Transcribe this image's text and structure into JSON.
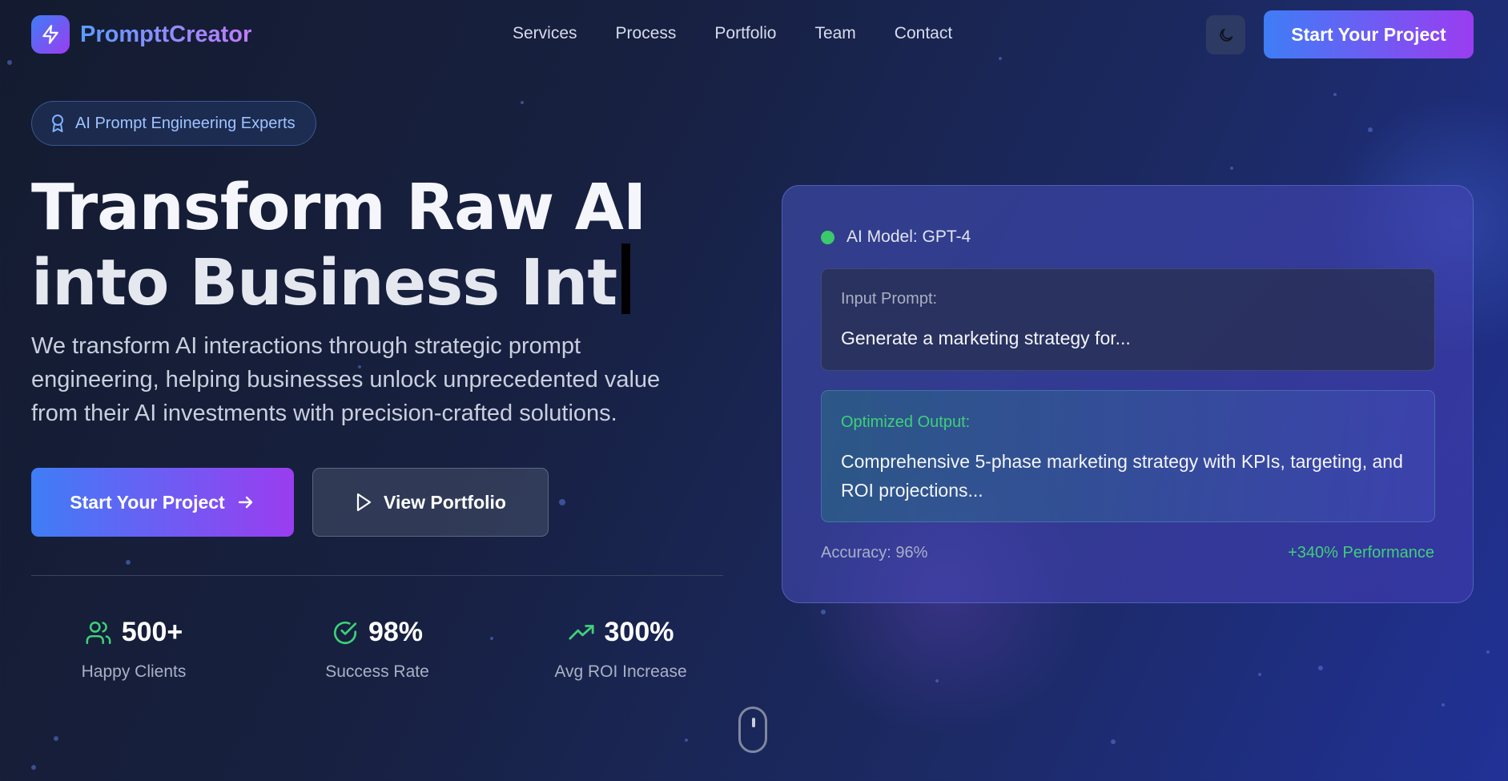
{
  "brand": {
    "name": "PrompttCreator",
    "logo_icon": "bolt-icon"
  },
  "nav": {
    "links": [
      "Services",
      "Process",
      "Portfolio",
      "Team",
      "Contact"
    ],
    "theme_icon": "moon-icon",
    "cta_label": "Start Your Project"
  },
  "hero": {
    "badge": "AI Prompt Engineering Experts",
    "badge_icon": "award-icon",
    "title_line1": "Transform Raw AI",
    "title_line2": "into Business Int",
    "description": "We transform AI interactions through strategic prompt engineering, helping businesses unlock unprecedented value from their AI investments with precision-crafted solutions.",
    "primary_button": "Start Your Project",
    "secondary_button": "View Portfolio"
  },
  "stats": [
    {
      "value": "500+",
      "label": "Happy Clients",
      "icon": "users-icon"
    },
    {
      "value": "98%",
      "label": "Success Rate",
      "icon": "check-circle-icon"
    },
    {
      "value": "300%",
      "label": "Avg ROI Increase",
      "icon": "trending-up-icon"
    }
  ],
  "demo": {
    "model": "AI Model: GPT-4",
    "input_label": "Input Prompt:",
    "input_text": "Generate a marketing strategy for...",
    "output_label": "Optimized Output:",
    "output_text": "Comprehensive 5-phase marketing strategy with KPIs, targeting, and ROI projections...",
    "accuracy": "Accuracy: 96%",
    "performance": "+340% Performance"
  },
  "colors": {
    "accent_blue": "#3f7df6",
    "accent_purple": "#9a3df0",
    "success_green": "#3ed07a"
  }
}
